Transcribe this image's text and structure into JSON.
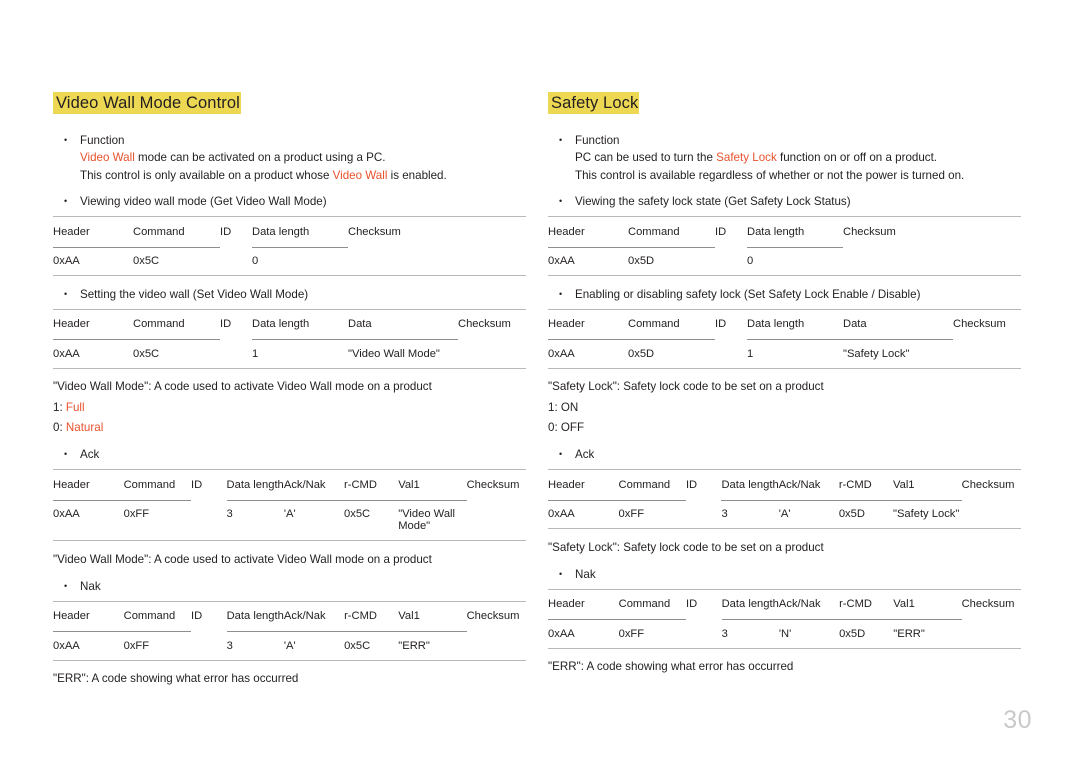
{
  "page": {
    "number": "30"
  },
  "left": {
    "title": "Video Wall Mode Control",
    "function_label": "Function",
    "function_line1_red": "Video Wall",
    "function_line1_rest": " mode can be activated on a product using a PC.",
    "function_line2_a": "This control is only available on a product whose ",
    "function_line2_red": "Video Wall",
    "function_line2_b": " is enabled.",
    "get_bullet": "Viewing video wall mode (Get Video Wall Mode)",
    "get_table": {
      "headers": [
        "Header",
        "Command",
        "ID",
        "Data length",
        "Checksum"
      ],
      "row": [
        "0xAA",
        "0x5C",
        "",
        "0",
        ""
      ]
    },
    "set_bullet": "Setting the video wall (Set Video Wall Mode)",
    "set_table": {
      "headers": [
        "Header",
        "Command",
        "ID",
        "Data length",
        "Data",
        "Checksum"
      ],
      "row": [
        "0xAA",
        "0x5C",
        "",
        "1",
        "\"Video Wall Mode\"",
        ""
      ]
    },
    "note_1": "\"Video Wall Mode\": A code used to activate Video Wall mode on a product",
    "value_1_key": "1: ",
    "value_1_val": "Full",
    "value_0_key": "0: ",
    "value_0_val": "Natural",
    "ack_bullet": "Ack",
    "ack_table": {
      "headers": [
        "Header",
        "Command",
        "ID",
        "Data length",
        "Ack/Nak",
        "r-CMD",
        "Val1",
        "Checksum"
      ],
      "row": [
        "0xAA",
        "0xFF",
        "",
        "3",
        "'A'",
        "0x5C",
        "\"Video Wall Mode\"",
        ""
      ]
    },
    "note_2": "\"Video Wall Mode\": A code used to activate Video Wall mode on a product",
    "nak_bullet": "Nak",
    "nak_table": {
      "headers": [
        "Header",
        "Command",
        "ID",
        "Data length",
        "Ack/Nak",
        "r-CMD",
        "Val1",
        "Checksum"
      ],
      "row": [
        "0xAA",
        "0xFF",
        "",
        "3",
        "'A'",
        "0x5C",
        "\"ERR\"",
        ""
      ]
    },
    "note_3": "\"ERR\": A code showing what error has occurred"
  },
  "right": {
    "title": "Safety Lock",
    "function_label": "Function",
    "function_line1_a": "PC can be used to turn the ",
    "function_line1_red": "Safety Lock",
    "function_line1_b": " function on or off on a product.",
    "function_line2": "This control is available regardless of whether or not the power is turned on.",
    "get_bullet": "Viewing the safety lock state (Get Safety Lock Status)",
    "get_table": {
      "headers": [
        "Header",
        "Command",
        "ID",
        "Data length",
        "Checksum"
      ],
      "row": [
        "0xAA",
        "0x5D",
        "",
        "0",
        ""
      ]
    },
    "set_bullet": "Enabling or disabling safety lock (Set Safety Lock Enable / Disable)",
    "set_table": {
      "headers": [
        "Header",
        "Command",
        "ID",
        "Data length",
        "Data",
        "Checksum"
      ],
      "row": [
        "0xAA",
        "0x5D",
        "",
        "1",
        "\"Safety Lock\"",
        ""
      ]
    },
    "note_1": "\"Safety Lock\": Safety lock code to be set on a product",
    "value_1": "1: ON",
    "value_0": "0: OFF",
    "ack_bullet": "Ack",
    "ack_table": {
      "headers": [
        "Header",
        "Command",
        "ID",
        "Data length",
        "Ack/Nak",
        "r-CMD",
        "Val1",
        "Checksum"
      ],
      "row": [
        "0xAA",
        "0xFF",
        "",
        "3",
        "'A'",
        "0x5D",
        "\"Safety Lock\"",
        ""
      ]
    },
    "note_2": "\"Safety Lock\": Safety lock code to be set on a product",
    "nak_bullet": "Nak",
    "nak_table": {
      "headers": [
        "Header",
        "Command",
        "ID",
        "Data length",
        "Ack/Nak",
        "r-CMD",
        "Val1",
        "Checksum"
      ],
      "row": [
        "0xAA",
        "0xFF",
        "",
        "3",
        "'N'",
        "0x5D",
        "\"ERR\"",
        ""
      ]
    },
    "note_3": "\"ERR\": A code showing what error has occurred"
  }
}
